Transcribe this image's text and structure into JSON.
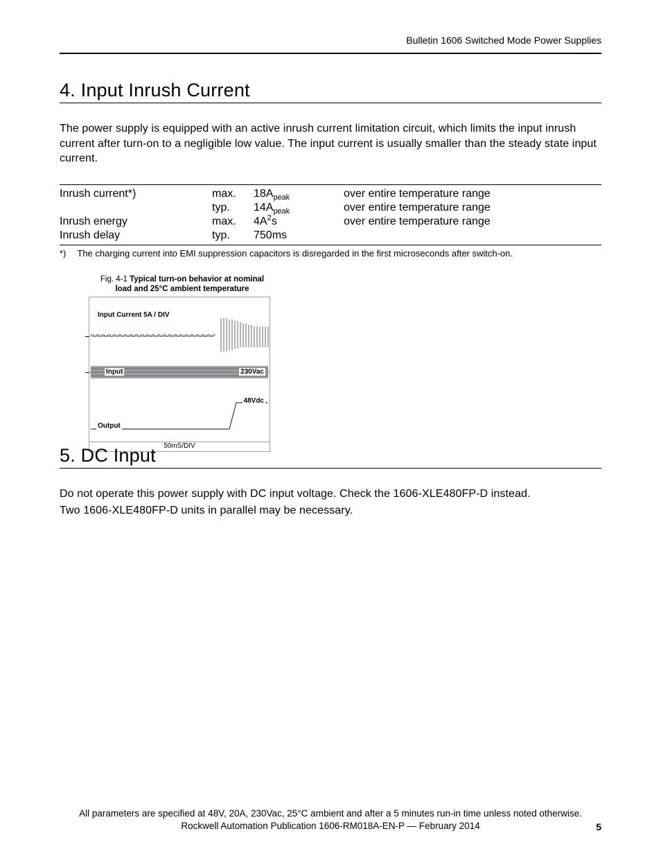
{
  "header": {
    "right": "Bulletin 1606 Switched Mode Power Supplies"
  },
  "section4": {
    "title": "4.  Input Inrush Current",
    "para": "The power supply is equipped with an active inrush current limitation circuit, which limits the input inrush current after turn-on to a negligible low value. The input current is usually smaller than the steady state input current.",
    "rows": [
      {
        "param": "Inrush current*)",
        "stat": "max.",
        "val_a": "18A",
        "val_b": "peak",
        "note": "over entire temperature range"
      },
      {
        "param": "",
        "stat": "typ.",
        "val_a": "14A",
        "val_b": "peak",
        "note": "over entire temperature range"
      },
      {
        "param": "Inrush energy",
        "stat": "max.",
        "val_a": "4A",
        "val_b": "2",
        "val_c": "s",
        "sup": true,
        "note": "over entire temperature range"
      },
      {
        "param": "Inrush delay",
        "stat": "typ.",
        "val_a": "750ms",
        "val_b": "",
        "note": ""
      }
    ],
    "footnote_mark": "*)",
    "footnote_text": "The charging current into EMI suppression capacitors is disregarded in the first microseconds after switch-on.",
    "figure": {
      "lead": "Fig. 4-1",
      "title_l1": "Typical turn-on behavior at nominal",
      "title_l2": "load and 25°C ambient temperature",
      "lbl_inputcurrent": "Input Current 5A / DIV",
      "lbl_input": "Input",
      "lbl_230vac": "230Vac",
      "lbl_48vdc": "48Vdc",
      "lbl_output": "Output",
      "timebase": "50mS/DIV"
    }
  },
  "section5": {
    "title": "5.  DC Input",
    "para1": "Do not operate this power supply with DC input voltage. Check the 1606-XLE480FP-D instead.",
    "para2": "Two 1606-XLE480FP-D units in parallel may be necessary."
  },
  "footer": {
    "line1": "All parameters are specified at 48V, 20A, 230Vac, 25°C ambient and after a 5 minutes run-in time unless noted otherwise.",
    "line2": "Rockwell Automation Publication 1606-RM018A-EN-P — February 2014"
  },
  "page_number": "5"
}
